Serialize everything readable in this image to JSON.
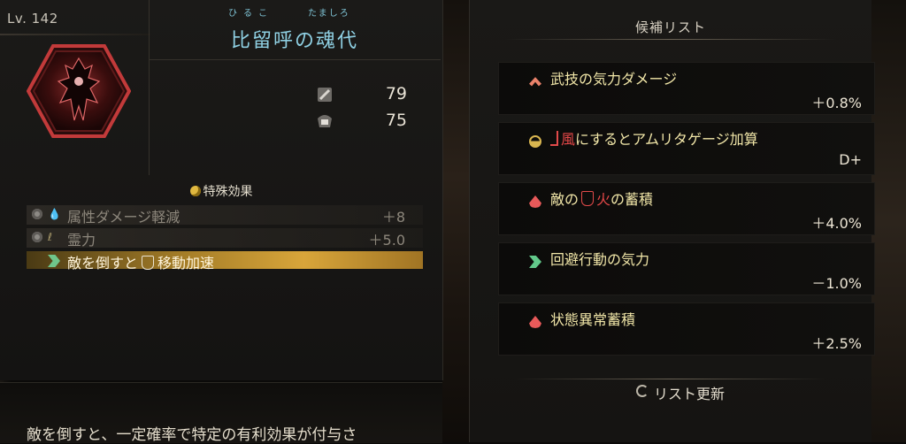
{
  "item": {
    "level": "Lv. 142",
    "furigana_1": "ひるこ",
    "furigana_2": "たましろ",
    "name": "比留呼の魂代",
    "stats": [
      {
        "icon": "attack-icon",
        "value": "79"
      },
      {
        "icon": "defense-icon",
        "value": "75"
      }
    ]
  },
  "special_effects": {
    "title": "特殊効果",
    "rows": [
      {
        "label": "属性ダメージ軽減",
        "value": "＋8"
      },
      {
        "label": "霊力",
        "value": "＋5.0"
      },
      {
        "label_before": "敵を倒すと",
        "label_after": "移動加速"
      }
    ]
  },
  "description": "敵を倒すと、一定確率で特定の有利効果が付与さ",
  "candidates": {
    "title": "候補リスト",
    "items": [
      {
        "icon": "skill-chevron-icon",
        "label": "武技の気力ダメージ",
        "value": "＋0.8%"
      },
      {
        "icon": "amrita-gauge-icon",
        "label_after": "にするとアムリタゲージ加算",
        "label_red": "風",
        "value": "D+"
      },
      {
        "icon": "blood-drop-icon",
        "label_a": "敵の",
        "label_red": "火",
        "label_b": "の蓄積",
        "value": "＋4.0%"
      },
      {
        "icon": "dodge-icon",
        "label": "回避行動の気力",
        "value": "－1.0%"
      },
      {
        "icon": "blood-drop-icon",
        "label": "状態異常蓄積",
        "value": "＋2.5%"
      }
    ],
    "refresh_label": "リスト更新"
  },
  "colors": {
    "accent_gold": "#d8a53a",
    "name_cyan": "#8fd0e3",
    "label_yellow": "#f1e6a8",
    "element_red": "#e54848"
  }
}
